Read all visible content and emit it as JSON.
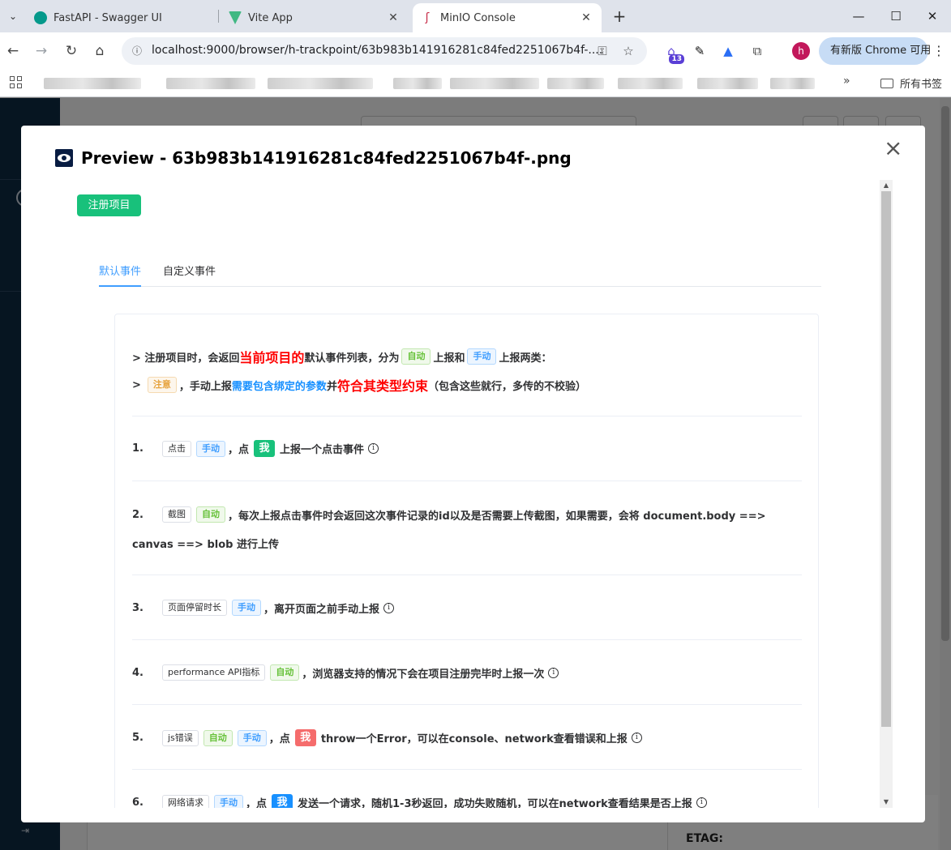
{
  "browser": {
    "tabs": [
      {
        "title": "FastAPI - Swagger UI",
        "icon_color": "#05998b"
      },
      {
        "title": "Vite App",
        "icon_color": "#41b883"
      },
      {
        "title": "MinIO Console",
        "icon_color": "#c72c48"
      }
    ],
    "url": "localhost:9000/browser/h-trackpoint/63b983b141916281c84fed2251067b4f-....",
    "profile_initial": "h",
    "ext_badge": "13",
    "update_label": "有新版 Chrome 可用",
    "bookmarks_folder": "所有书签"
  },
  "page_behind": {
    "etag_label": "ETAG:"
  },
  "modal": {
    "title": "Preview - 63b983b141916281c84fed2251067b4f-.png",
    "register_button": "注册项目",
    "tabs": [
      "默认事件",
      "自定义事件"
    ],
    "intro": {
      "line1": {
        "prefix": "> 注册项目时，会返回",
        "highlight": "当前项目的",
        "mid": "默认事件列表，分为",
        "tag_auto": "自动",
        "mid2": "上报和",
        "tag_manual": "手动",
        "suffix": "上报两类："
      },
      "line2": {
        "prefix": ">",
        "tag_warn": "注意",
        "mid": "，手动上报",
        "blue": "需要包含绑定的参数",
        "mid2": "并",
        "highlight": "符合其类型约束",
        "suffix": "（包含这些就行，多传的不校验）"
      }
    },
    "items": [
      {
        "num": "1.",
        "tags": [
          {
            "text": "点击",
            "kind": "plain"
          },
          {
            "text": "手动",
            "kind": "manual"
          }
        ],
        "text_a": "，点",
        "me": "我",
        "me_color": "green",
        "text_b": "上报一个点击事件",
        "info": true
      },
      {
        "num": "2.",
        "tags": [
          {
            "text": "截图",
            "kind": "plain"
          },
          {
            "text": "自动",
            "kind": "auto"
          }
        ],
        "text_a": "，每次上报点击事件时会返回这次事件记录的id以及是否需要上传截图，如果需要，会将 document.body ==>",
        "text_c": "canvas ==> blob 进行上传"
      },
      {
        "num": "3.",
        "tags": [
          {
            "text": "页面停留时长",
            "kind": "plain"
          },
          {
            "text": "手动",
            "kind": "manual"
          }
        ],
        "text_a": "，离开页面之前手动上报",
        "info": true
      },
      {
        "num": "4.",
        "tags": [
          {
            "text": "performance API指标",
            "kind": "plain"
          },
          {
            "text": "自动",
            "kind": "auto"
          }
        ],
        "text_a": "，浏览器支持的情况下会在项目注册完毕时上报一次",
        "info": true
      },
      {
        "num": "5.",
        "tags": [
          {
            "text": "js错误",
            "kind": "plain"
          },
          {
            "text": "自动",
            "kind": "auto"
          },
          {
            "text": "手动",
            "kind": "manual"
          }
        ],
        "text_a": "，点",
        "me": "我",
        "me_color": "red",
        "text_b": "throw一个Error，可以在console、network查看错误和上报",
        "info": true
      },
      {
        "num": "6.",
        "tags": [
          {
            "text": "网络请求",
            "kind": "plain"
          },
          {
            "text": "手动",
            "kind": "manual"
          }
        ],
        "text_a": "，点",
        "me": "我",
        "me_color": "blue",
        "text_b": "发送一个请求，随机1-3秒返回，成功失败随机，可以在network查看结果是否上报",
        "info": true
      }
    ]
  }
}
